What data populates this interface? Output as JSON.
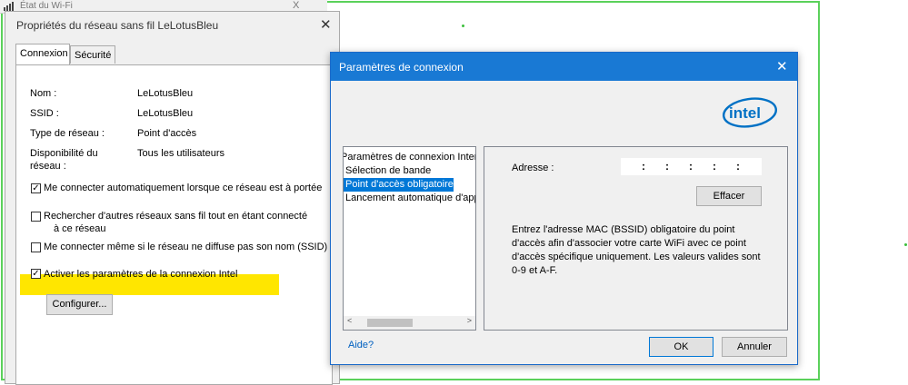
{
  "background_window": {
    "title": "État du Wi-Fi",
    "close": "X"
  },
  "properties_window": {
    "title": "Propriétés du réseau sans fil LeLotusBleu",
    "close": "✕",
    "tabs": [
      {
        "label": "Connexion",
        "active": true
      },
      {
        "label": "Sécurité",
        "active": false
      }
    ],
    "fields": {
      "nom_label": "Nom :",
      "nom_value": "LeLotusBleu",
      "ssid_label": "SSID :",
      "ssid_value": "LeLotusBleu",
      "type_label": "Type de réseau :",
      "type_value": "Point d'accès",
      "dispo_label_1": "Disponibilité du",
      "dispo_label_2": "réseau :",
      "dispo_value": "Tous les utilisateurs"
    },
    "checkboxes": [
      {
        "label": "Me connecter automatiquement lorsque ce réseau est à portée",
        "checked": true
      },
      {
        "label": "Rechercher d'autres réseaux sans fil tout en étant connecté",
        "label2": "à ce réseau",
        "checked": false
      },
      {
        "label": "Me connecter même si le réseau ne diffuse pas son nom (SSID)",
        "checked": false
      },
      {
        "label": "Activer les paramètres de la connexion Intel",
        "checked": true
      }
    ],
    "configure_button": "Configurer...",
    "highlight_color": "#ffe600"
  },
  "connection_dialog": {
    "title": "Paramètres de connexion",
    "close": "✕",
    "logo_text": "intel",
    "brand_color": "#1979d4",
    "list_items": [
      {
        "label": "Paramètres de connexion Internet",
        "selected": false
      },
      {
        "label": "Sélection de bande",
        "selected": false
      },
      {
        "label": "Point d'accès obligatoire",
        "selected": true
      },
      {
        "label": "Lancement automatique d'application",
        "selected": false
      }
    ],
    "address_label": "Adresse :",
    "mac_separator": ":",
    "clear_button": "Effacer",
    "description": "Entrez l'adresse MAC (BSSID) obligatoire du point d'accès afin d'associer votre carte WiFi avec ce point d'accès spécifique uniquement. Les valeurs valides sont 0-9 et A-F.",
    "help_link": "Aide?",
    "ok_button": "OK",
    "cancel_button": "Annuler"
  }
}
